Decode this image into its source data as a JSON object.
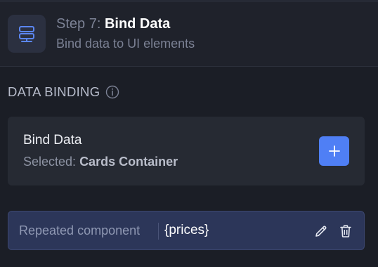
{
  "colors": {
    "background": "#1b1e26",
    "header_bg": "#1f222b",
    "card_bg": "#262a33",
    "accent": "#4f7ff5",
    "repeat_row_bg": "#2c3659"
  },
  "step": {
    "prefix": "Step 7: ",
    "name": "Bind Data",
    "subtitle": "Bind data to UI elements",
    "icon": "database-stack-icon"
  },
  "section": {
    "heading": "DATA BINDING",
    "info_icon": "info-icon"
  },
  "bind_card": {
    "title": "Bind Data",
    "selected_label": "Selected: ",
    "selected_value": "Cards Container",
    "add_icon": "plus-icon"
  },
  "repeated": {
    "label": "Repeated component",
    "value": "{prices}",
    "edit_icon": "pencil-icon",
    "delete_icon": "trash-icon"
  }
}
